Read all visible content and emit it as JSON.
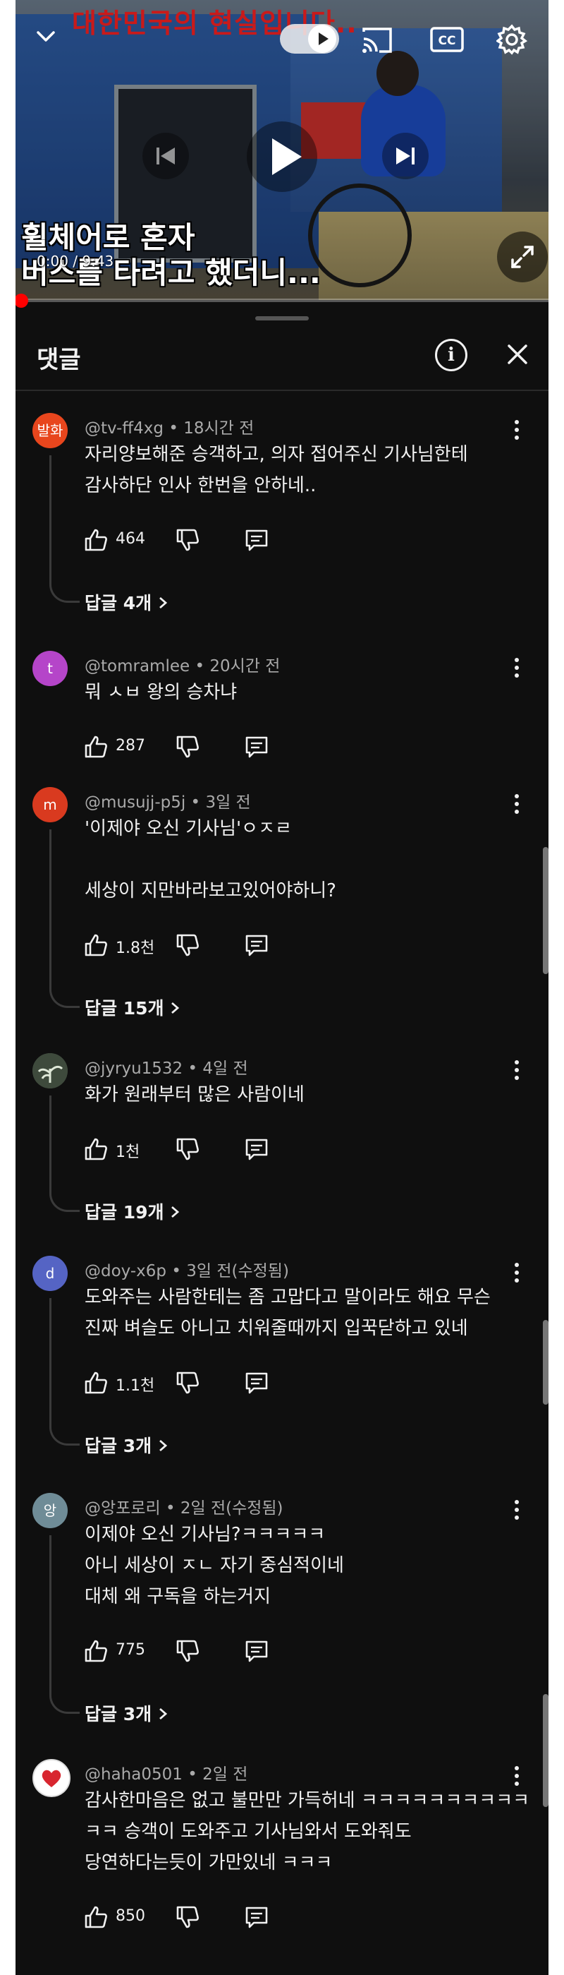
{
  "video": {
    "top_overlay_text": "대한민국의 현실입니다..",
    "caption_line1": "휠체어로 혼자",
    "caption_line2": "버스를 타려고 했더니...",
    "timecode": "0:00 / 9:43",
    "progress_fraction": 0,
    "cc_label": "CC",
    "icons": [
      "chevron-down-icon",
      "autoplay-toggle",
      "cast-icon",
      "cc-icon",
      "settings-gear-icon",
      "previous-icon",
      "play-icon",
      "next-icon",
      "fullscreen-icon"
    ]
  },
  "header": {
    "title": "댓글",
    "info_label": "i"
  },
  "comments": [
    {
      "avatar_text": "발화",
      "avatar_color": "#e8461d",
      "author": "@tv-ff4xg",
      "time": "18시간 전",
      "lines": [
        "자리양보해준 승객하고, 의자 접어주신 기사님한테",
        "감사하단 인사 한번을 안하네.."
      ],
      "likes": "464",
      "replies": "답글 4개"
    },
    {
      "avatar_text": "t",
      "avatar_color": "#b545c9",
      "author": "@tomramlee",
      "time": "20시간 전",
      "lines": [
        "뭐 ㅅㅂ 왕의 승차냐"
      ],
      "likes": "287",
      "replies": ""
    },
    {
      "avatar_text": "m",
      "avatar_color": "#d93a1f",
      "author": "@musujj-p5j",
      "time": "3일 전",
      "lines": [
        "'이제야 오신 기사님'ㅇㅈㄹ",
        "",
        "세상이 지만바라보고있어야하니?"
      ],
      "likes": "1.8천",
      "replies": "답글 15개"
    },
    {
      "avatar_text": "",
      "avatar_color": "#4a5a48",
      "author": "@jyryu1532",
      "time": "4일 전",
      "lines": [
        "화가 원래부터 많은 사람이네"
      ],
      "likes": "1천",
      "replies": "답글 19개"
    },
    {
      "avatar_text": "d",
      "avatar_color": "#5564c4",
      "author": "@doy-x6p",
      "time": "3일 전(수정됨)",
      "lines": [
        "도와주는 사람한테는 좀 고맙다고 말이라도 해요 무슨",
        "진짜 벼슬도 아니고 치워줄때까지 입꾹닫하고 있네"
      ],
      "likes": "1.1천",
      "replies": "답글 3개"
    },
    {
      "avatar_text": "앙",
      "avatar_color": "#6f8c97",
      "author": "@앙포로리",
      "time": "2일 전(수정됨)",
      "lines": [
        "이제야 오신 기사님?ㅋㅋㅋㅋㅋ",
        "아니 세상이 ㅈㄴ 자기 중심적이네",
        "대체 왜 구독을 하는거지"
      ],
      "likes": "775",
      "replies": "답글 3개"
    },
    {
      "avatar_text": "",
      "avatar_color": "#ffffff",
      "author": "@haha0501",
      "time": "2일 전",
      "lines": [
        "감사한마음은 없고 불만만 가득허네 ㅋㅋㅋㅋㅋㅋㅋㅋㅋㅋ",
        "ㅋㅋ 승객이 도와주고 기사님와서 도와줘도",
        "당연하다는듯이 가만있네 ㅋㅋㅋ"
      ],
      "likes": "850",
      "replies": ""
    }
  ]
}
